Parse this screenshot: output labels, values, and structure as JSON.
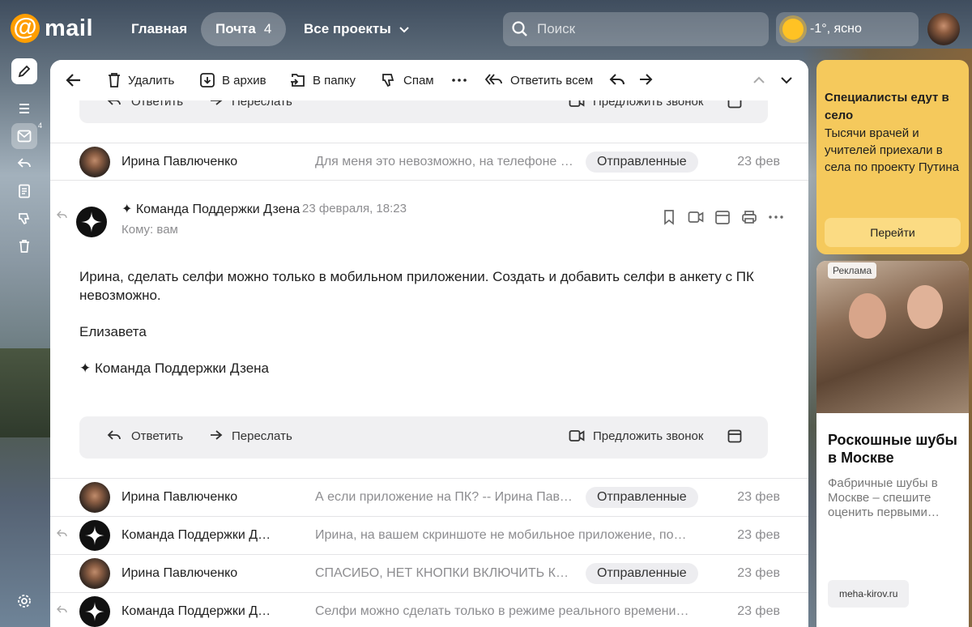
{
  "header": {
    "logo_text": "mail",
    "nav": {
      "home": "Главная",
      "mail": "Почта",
      "mail_count": "4",
      "projects": "Все проекты"
    },
    "search_placeholder": "Поиск",
    "weather": "-1°, ясно"
  },
  "rail": {
    "inbox_badge": "4"
  },
  "toolbar": {
    "delete": "Удалить",
    "archive": "В архив",
    "to_folder": "В папку",
    "spam": "Спам",
    "reply_all": "Ответить всем"
  },
  "actions": {
    "reply": "Ответить",
    "forward": "Переслать",
    "call": "Предложить звонок"
  },
  "rows_top": [
    {
      "sender": "Ирина Павлюченко",
      "snippet": "Для меня это невозможно, на телефоне др…",
      "tag": "Отправленные",
      "date": "23 фев"
    }
  ],
  "message": {
    "from": "✦ Команда Поддержки Дзена",
    "date": "23 февраля, 18:23",
    "to": "Кому: вам",
    "body": [
      "Ирина, сделать селфи можно только в мобильном приложении. Создать и добавить селфи в анкету с ПК невозможно.",
      "Елизавета",
      "✦ Команда Поддержки Дзена"
    ]
  },
  "rows_bottom": [
    {
      "sender": "Ирина Павлюченко",
      "snippet": "А если приложение на ПК? -- Ирина Павлю…",
      "tag": "Отправленные",
      "date": "23 фев"
    },
    {
      "sender": "Команда Поддержки Д…",
      "snippet": "Ирина, на вашем скриншоте не мобильное приложение, посто…",
      "tag": "",
      "date": "23 фев"
    },
    {
      "sender": "Ирина Павлюченко",
      "snippet": "СПАСИБО, НЕТ КНОПКИ ВКЛЮЧИТЬ КАМ…",
      "tag": "Отправленные",
      "date": "23 фев"
    },
    {
      "sender": "Команда Поддержки Д…",
      "snippet": "Селфи можно сделать только в режиме реального времени че…",
      "tag": "",
      "date": "23 фев"
    }
  ],
  "ads": {
    "ad1": {
      "title": "Специалисты едут в село",
      "text": "Тысячи врачей и учителей приехали в села по проекту Путина",
      "button": "Перейти"
    },
    "ad2": {
      "label": "Реклама",
      "title": "Роскошные шубы в Москве",
      "text": "Фабричные шубы в Москве – спешите оценить первыми…",
      "domain": "meha-kirov.ru"
    }
  },
  "colors": {
    "accent": "#ff9e00",
    "ad_yellow": "#f5c95c"
  }
}
